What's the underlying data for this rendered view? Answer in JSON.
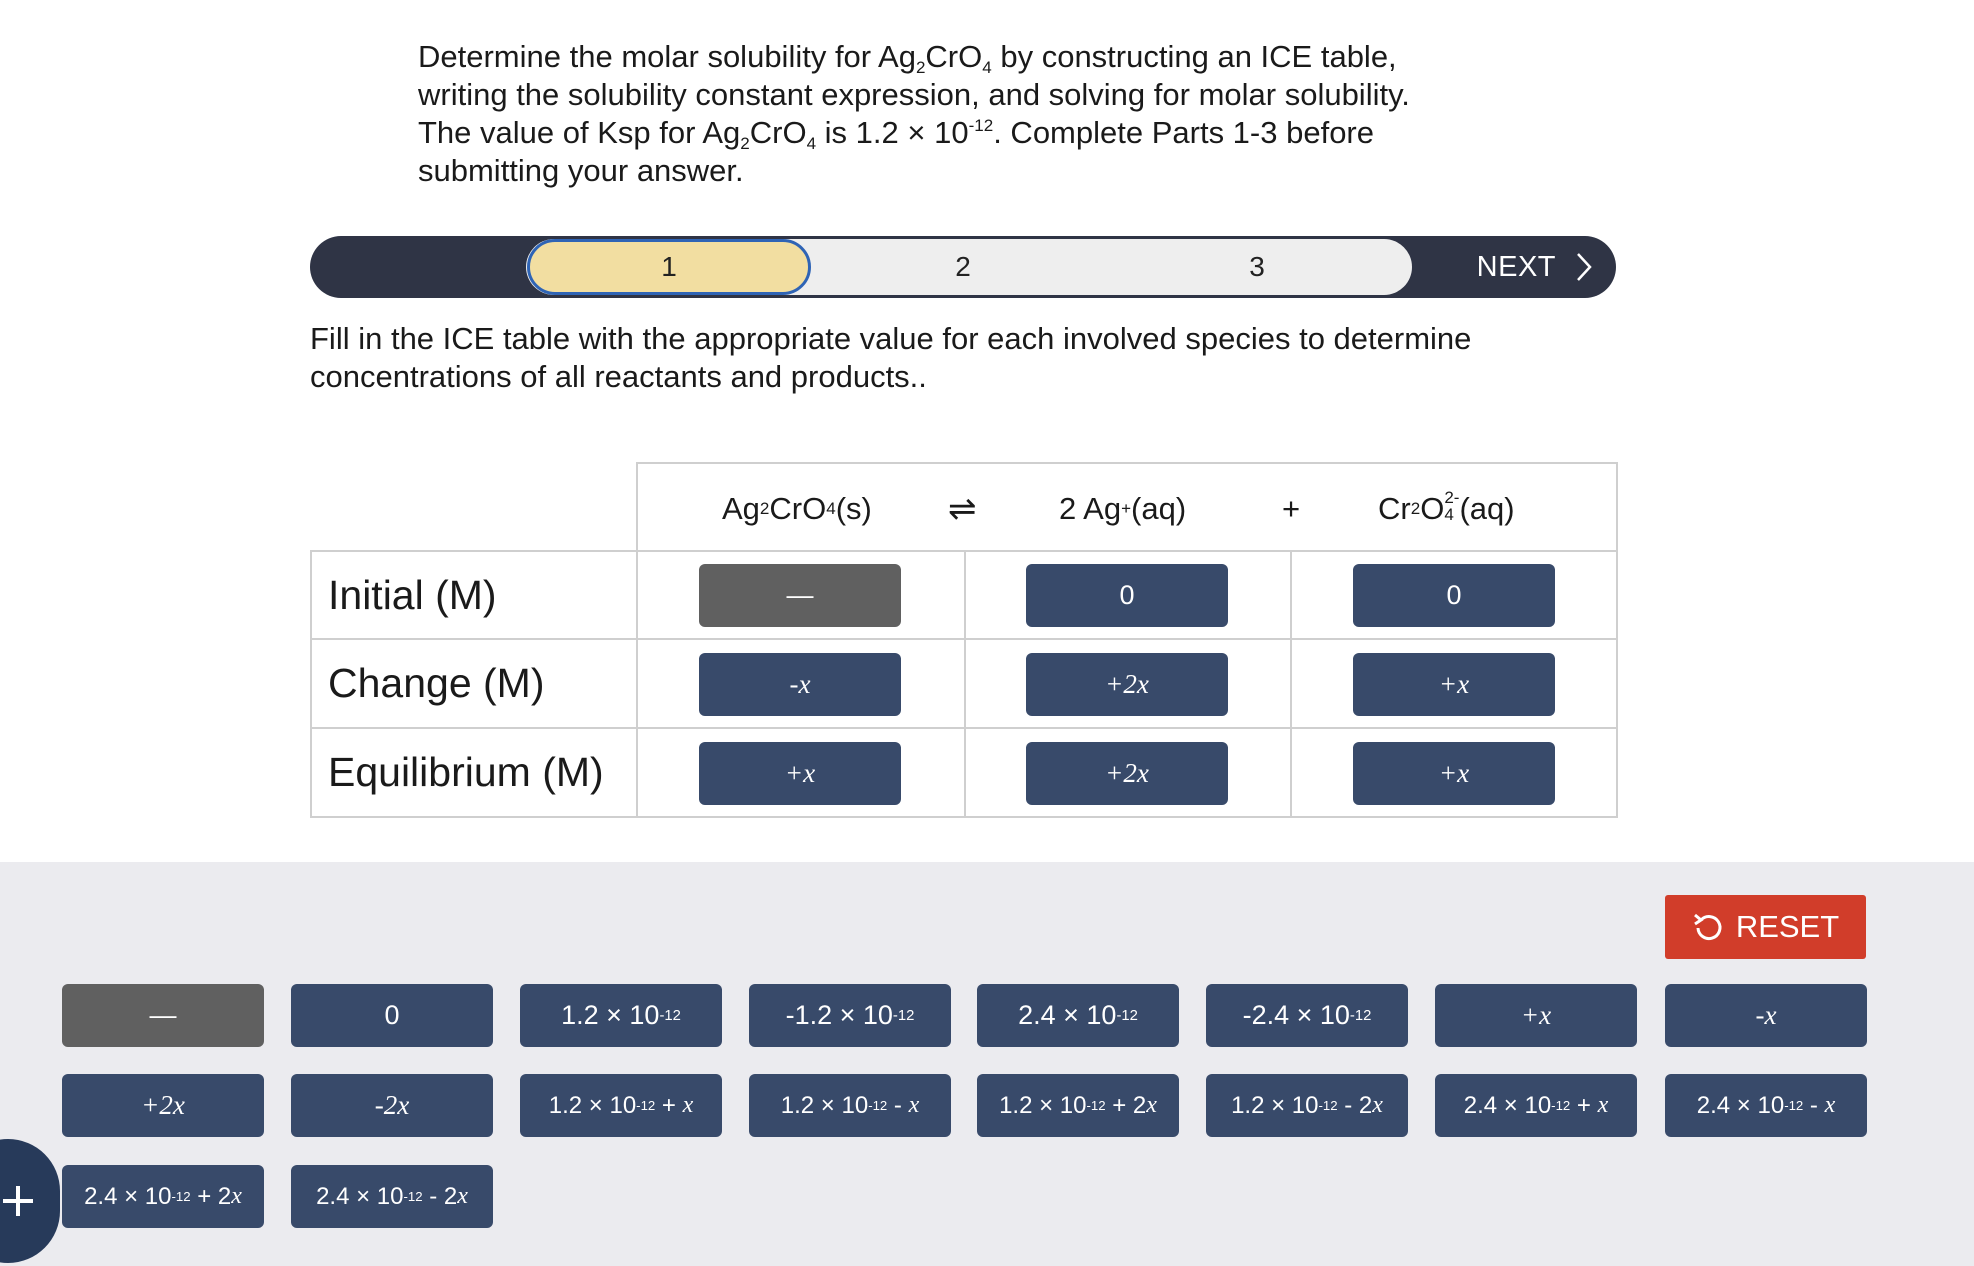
{
  "prompt": {
    "l1a": "Determine the molar solubility for Ag",
    "l1b": "2",
    "l1c": "CrO",
    "l1d": "4",
    "l1e": " by constructing an ICE table,",
    "l2": "writing the solubility constant expression, and solving for molar solubility.",
    "l3a": "The value of Ksp for Ag",
    "l3b": "2",
    "l3c": "CrO",
    "l3d": "4",
    "l3e": " is 1.2 × 10",
    "l3f": "-12",
    "l3g": ". Complete Parts 1-3 before",
    "l4": "submitting your answer."
  },
  "stepper": {
    "steps": [
      "1",
      "2",
      "3"
    ],
    "active_step": 1,
    "next_label": "NEXT"
  },
  "instruction": {
    "l1": "Fill in the ICE table with the appropriate value for each involved species to determine",
    "l2": "concentrations of all reactants and products.."
  },
  "equation": {
    "reactant": {
      "a": "Ag",
      "b": "2",
      "c": "CrO",
      "d": "4",
      "e": "(s)"
    },
    "arrow": "⇌",
    "product1": {
      "a": "2 Ag",
      "b": "+",
      "c": "(aq)"
    },
    "plus": "+",
    "product2": {
      "a": "Cr",
      "b": "2",
      "c": "O",
      "d": "4",
      "e": "2-",
      "f": "(aq)"
    }
  },
  "rows": {
    "initial": "Initial (M)",
    "change": "Change (M)",
    "equilibrium": "Equilibrium (M)"
  },
  "table": {
    "initial": [
      "—",
      "0",
      "0"
    ],
    "change": [
      "-x",
      "+2x",
      "+x"
    ],
    "equilibrium": [
      "+x",
      "+2x",
      "+x"
    ]
  },
  "reset_label": "RESET",
  "bank": {
    "row1": [
      "—",
      "0",
      "1.2 × 10-12",
      "-1.2 × 10-12",
      "2.4 × 10-12",
      "-2.4 × 10-12",
      "+x",
      "-x"
    ],
    "row2": [
      "+2x",
      "-2x",
      "1.2 × 10-12 + x",
      "1.2 × 10-12 - x",
      "1.2 × 10-12 + 2x",
      "1.2 × 10-12 - 2x",
      "2.4 × 10-12 + x",
      "2.4 × 10-12 - x"
    ],
    "row3": [
      "2.4 × 10-12 + 2x",
      "2.4 × 10-12 - 2x"
    ]
  },
  "colors": {
    "tile": "#384a6a",
    "tile_dash": "#606060",
    "active_step": "#f2dea1",
    "active_border": "#2f64b5",
    "reset": "#d13d2a",
    "bank_bg": "#ebebef",
    "stepper_dark": "#2f3445"
  },
  "icons": {
    "next": "chevron-right-icon",
    "reset": "undo-icon",
    "add": "plus-icon"
  }
}
